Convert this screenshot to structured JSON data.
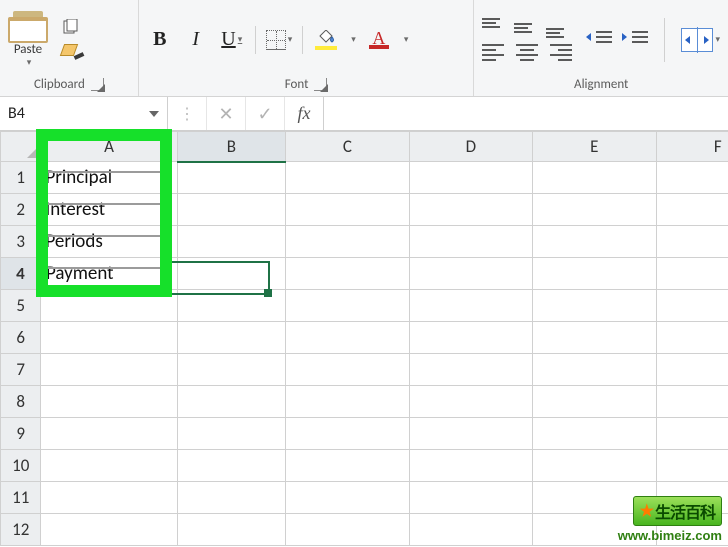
{
  "ribbon": {
    "clipboard": {
      "label": "Clipboard",
      "paste": "Paste"
    },
    "font": {
      "label": "Font",
      "bold": "B",
      "italic": "I",
      "underline": "U"
    },
    "alignment": {
      "label": "Alignment"
    }
  },
  "formulaBar": {
    "nameBox": "B4",
    "fx": "fx",
    "formula": ""
  },
  "sheet": {
    "columns": [
      "A",
      "B",
      "C",
      "D",
      "E",
      "F"
    ],
    "rows": [
      "1",
      "2",
      "3",
      "4",
      "5",
      "6",
      "7",
      "8",
      "9",
      "10",
      "11",
      "12"
    ],
    "activeCell": "B4",
    "cells": {
      "A1": "Principal",
      "A2": "Interest",
      "A3": "Periods",
      "A4": "Payment"
    }
  },
  "watermark": {
    "brand": "生活百科",
    "url": "www.bimeiz.com"
  },
  "colors": {
    "excelGreen": "#1f7246",
    "highlightGreen": "#16e02a",
    "fillYellow": "#ffeb3b",
    "fontRed": "#c62828"
  }
}
